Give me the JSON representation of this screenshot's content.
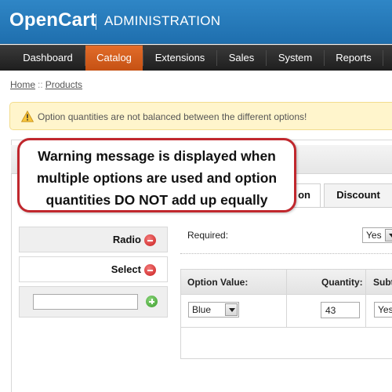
{
  "header": {
    "brand": "OpenCart",
    "subtitle": "ADMINISTRATION"
  },
  "menu": {
    "items": [
      "Dashboard",
      "Catalog",
      "Extensions",
      "Sales",
      "System",
      "Reports"
    ],
    "active": "Catalog"
  },
  "breadcrumb": {
    "home": "Home",
    "separator": "::",
    "current": "Products"
  },
  "warning": {
    "text": "Option quantities are not balanced between the different options!",
    "icon": "warning-triangle-icon"
  },
  "tabs": {
    "option_fragment": "on",
    "discount": "Discount"
  },
  "options": {
    "items": [
      "Radio",
      "Select"
    ],
    "add_input_value": ""
  },
  "form": {
    "required_label": "Required:",
    "required_value_fragment": "Yes",
    "table_headers": [
      "Option Value:",
      "Quantity:",
      "Subt"
    ],
    "row": {
      "option_value": "Blue",
      "quantity": "43",
      "subtract_fragment": "Yes"
    }
  },
  "callout": {
    "lines": [
      "Warning message is displayed when",
      "multiple options are used and option",
      "quantities DO NOT add up equally"
    ],
    "border_color": "#c0272d"
  },
  "colors": {
    "header_blue": "#2a7fc0",
    "menu_dark": "#2b2b2b",
    "menu_active": "#d45f1f",
    "warning_bg": "#fff5cc"
  }
}
